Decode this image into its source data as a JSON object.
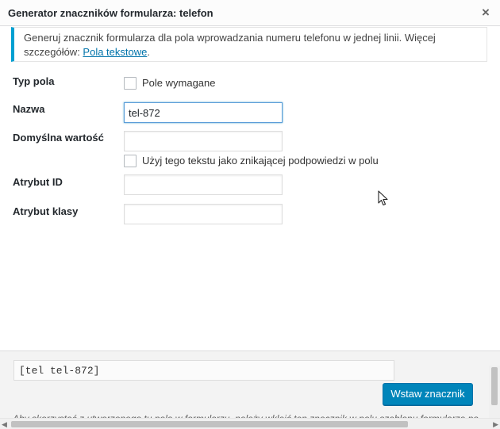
{
  "window": {
    "title": "Generator znaczników formularza: telefon",
    "close_symbol": "×"
  },
  "notice": {
    "text": "Generuj znacznik formularza dla pola wprowadzania numeru telefonu w jednej linii. Więcej szczegółów: ",
    "link_text": "Pola tekstowe",
    "after_link": "."
  },
  "form": {
    "field_type": {
      "label": "Typ pola",
      "checkbox_label": "Pole wymagane",
      "checked": false
    },
    "name": {
      "label": "Nazwa",
      "value": "tel-872"
    },
    "default_value": {
      "label": "Domyślna wartość",
      "value": "",
      "checkbox_label": "Użyj tego tekstu jako znikającej podpowiedzi w polu",
      "checked": false
    },
    "id_attr": {
      "label": "Atrybut ID",
      "value": ""
    },
    "class_attr": {
      "label": "Atrybut klasy",
      "value": ""
    }
  },
  "footer": {
    "tag_value": "[tel tel-872]",
    "insert_button": "Wstaw znacznik",
    "help_text": "Aby skorzystać z utworzonego tu pola w formularzu, należy wkleić ten znacznik w polu szablonu formularza po lewej stronie."
  },
  "colors": {
    "accent": "#0085ba",
    "notice_border": "#00a0d2",
    "link": "#0073aa"
  },
  "icons": {
    "close": "close-icon",
    "cursor": "mouse-pointer-icon"
  }
}
